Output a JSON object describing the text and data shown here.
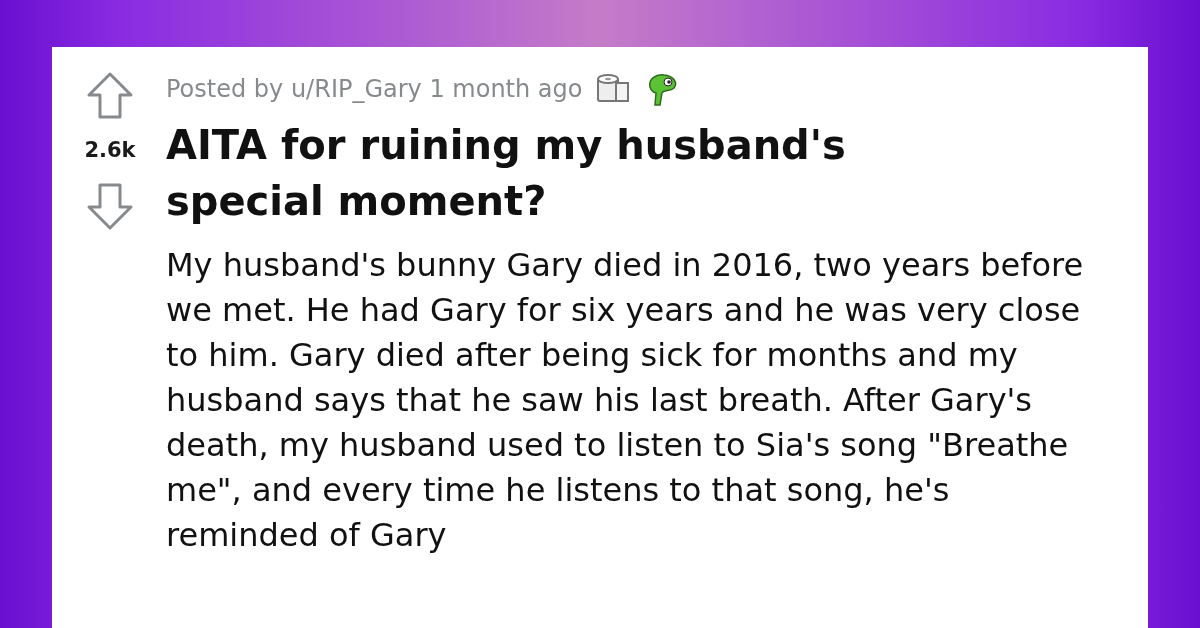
{
  "post": {
    "votes": "2.6k",
    "posted_by": "Posted by u/RIP_Gary 1 month ago",
    "title": "AITA for ruining my husband's special moment?",
    "body": "My husband's bunny Gary died in 2016, two years before we met. He had Gary for six years and he was very close to him. Gary died after being sick for months and my husband says that he saw his last breath. After Gary's death, my husband used to listen to Sia's song \"Breathe me\", and every time he listens to that song, he's reminded of Gary"
  }
}
